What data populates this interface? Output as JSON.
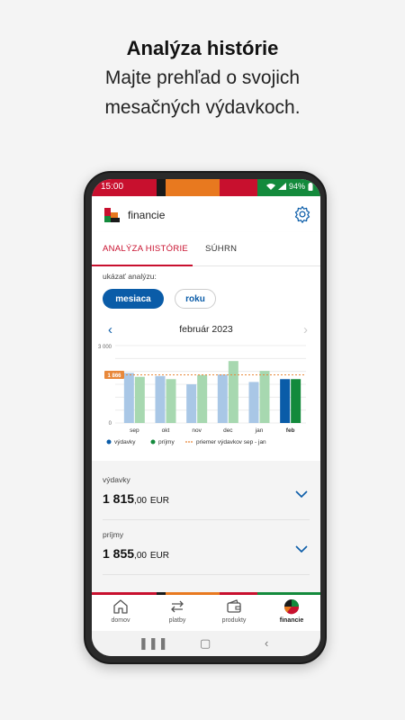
{
  "promo": {
    "title": "Analýza histórie",
    "line1": "Majte prehľad o svojich",
    "line2": "mesačných výdavkoch."
  },
  "status": {
    "time": "15:00",
    "battery": "94%"
  },
  "app": {
    "title": "financie"
  },
  "tabs": [
    {
      "label": "ANALÝZA HISTÓRIE",
      "active": true
    },
    {
      "label": "SÚHRN",
      "active": false
    }
  ],
  "filter": {
    "label": "ukázať analýzu:",
    "options": [
      {
        "label": "mesiaca",
        "selected": true
      },
      {
        "label": "roku",
        "selected": false
      }
    ]
  },
  "period": {
    "label": "február 2023"
  },
  "colors": {
    "expenses": "#a9c7e6",
    "income": "#a7d8b0",
    "expenses_current": "#0a5ca8",
    "income_current": "#138a3c",
    "average": "#e8883a"
  },
  "chart_data": {
    "type": "bar",
    "categories": [
      "sep",
      "okt",
      "nov",
      "dec",
      "jan",
      "feb"
    ],
    "series": [
      {
        "name": "výdavky",
        "values": [
          1940,
          1820,
          1500,
          1880,
          1590,
          1700
        ]
      },
      {
        "name": "príjmy",
        "values": [
          1790,
          1700,
          1860,
          2400,
          2020,
          1700
        ]
      }
    ],
    "average": {
      "label": "priemer výdavkov sep - jan",
      "value": 1866,
      "display": "1 866"
    },
    "ylim": [
      0,
      3000
    ],
    "y_ticks": [
      "3 000",
      "0"
    ],
    "highlight_category": "feb",
    "legend": [
      "výdavky",
      "príjmy",
      "priemer výdavkov sep - jan"
    ],
    "legend_position": "bottom",
    "grid": true
  },
  "summary": [
    {
      "label": "výdavky",
      "amount_main": "1 815",
      "amount_dec": ",00",
      "currency": "EUR"
    },
    {
      "label": "príjmy",
      "amount_main": "1 855",
      "amount_dec": ",00",
      "currency": "EUR"
    }
  ],
  "nav": [
    {
      "label": "domov",
      "icon": "home-icon",
      "active": false
    },
    {
      "label": "platby",
      "icon": "transfer-icon",
      "active": false
    },
    {
      "label": "produkty",
      "icon": "wallet-icon",
      "active": false
    },
    {
      "label": "financie",
      "icon": "pie-chart-icon",
      "active": true
    }
  ]
}
